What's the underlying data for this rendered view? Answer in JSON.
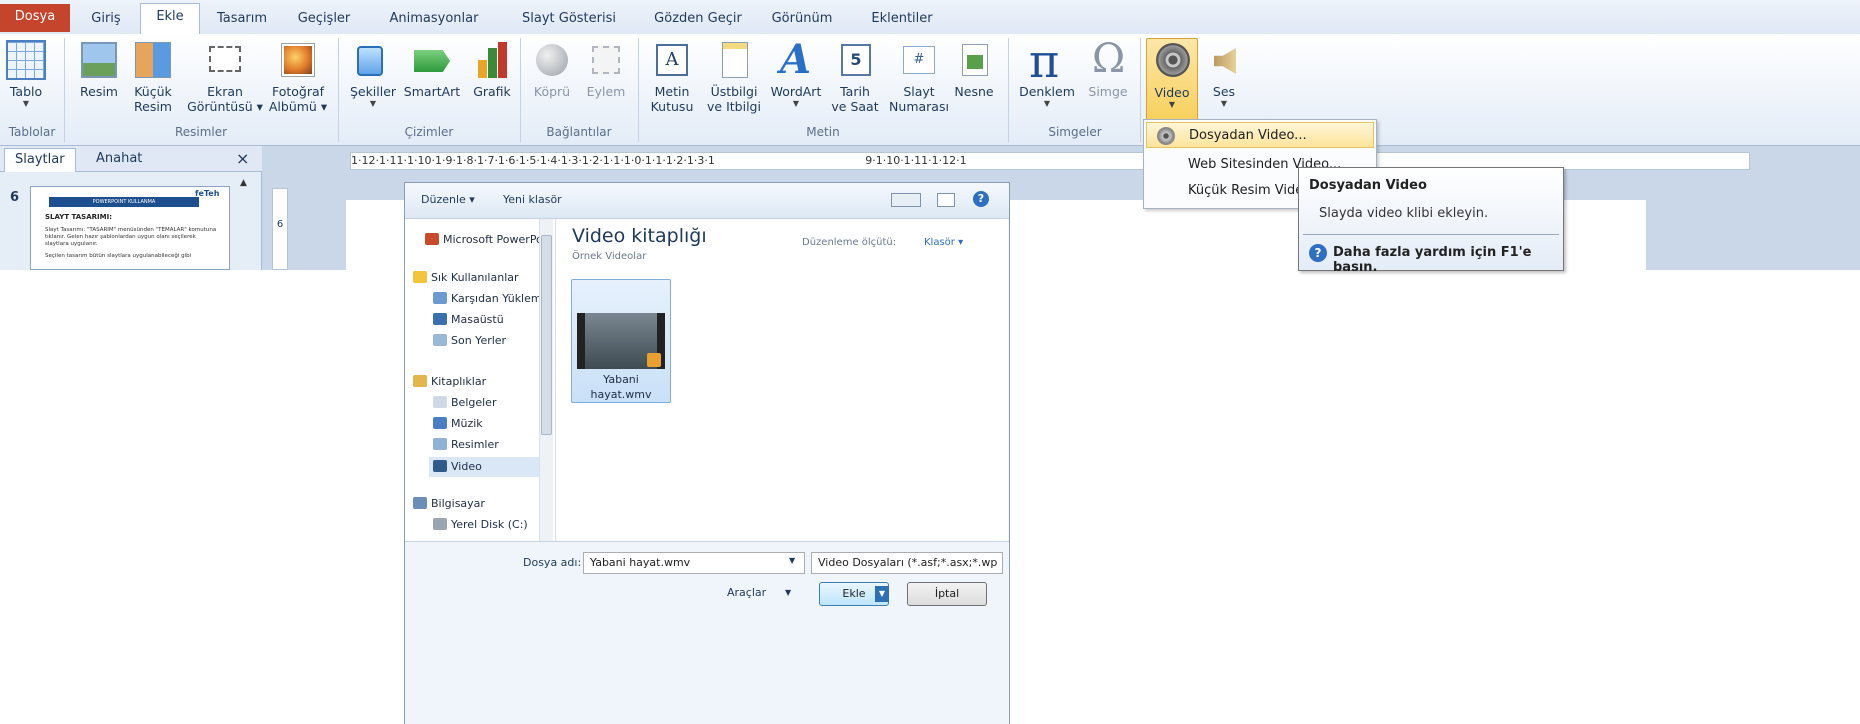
{
  "tabs": [
    "Dosya",
    "Giriş",
    "Ekle",
    "Tasarım",
    "Geçişler",
    "Animasyonlar",
    "Slayt Gösterisi",
    "Gözden Geçir",
    "Görünüm",
    "Eklentiler"
  ],
  "ribbon": {
    "tablo": "Tablo",
    "resim": "Resim",
    "kucuk_resim": [
      "Küçük",
      "Resim"
    ],
    "ekran": [
      "Ekran",
      "Görüntüsü"
    ],
    "fotograf": [
      "Fotoğraf",
      "Albümü"
    ],
    "sekiller": "Şekiller",
    "smartart": "SmartArt",
    "grafik": "Grafik",
    "kopru": "Köprü",
    "eylem": "Eylem",
    "metin_kutusu": [
      "Metin",
      "Kutusu"
    ],
    "ustbilgi": [
      "Üstbilgi",
      "ve Itbilgi"
    ],
    "wordart": "WordArt",
    "tarih": [
      "Tarih",
      "ve Saat"
    ],
    "slayt_num": [
      "Slayt",
      "Numarası"
    ],
    "nesne": "Nesne",
    "denklem": "Denklem",
    "simge": "Simge",
    "video": "Video",
    "ses": "Ses",
    "groups": {
      "tablolar": "Tablolar",
      "resimler": "Resimler",
      "cizimler": "Çizimler",
      "baglantilar": "Bağlantılar",
      "metin": "Metin",
      "simgeler": "Simgeler"
    },
    "icon_names": {
      "calendar_digit": "5",
      "number_sign": "#",
      "textbox_glyph": "A"
    }
  },
  "pane": {
    "tab_slides": "Slaytlar",
    "tab_outline": "Anahat",
    "close": "×",
    "slide_number": "6"
  },
  "thumb": {
    "header": "POWERPOINT KULLANMA",
    "logo": "feTeh",
    "title": "SLAYT TASARIMI:",
    "bullets": [
      "Slayt Tasarımı: \"TASARIM\" menüsünden \"TEMALAR\" komutuna tıklanır. Gelen hazır şablonlardan uygun olanı seçilerek slaytlara uygulanır.",
      "Seçilen tasarım bütün slaytlara uygulanabileceği gibi"
    ]
  },
  "ruler_text": "1·12·1·11·1·10·1·9·1·8·1·7·1·6·1·5·1·4·1·3·1·2·1·1·1·0·1·1·1·2·1·3·1",
  "ruler_right": "9·1·10·1·11·1·12·1",
  "vruler": "6",
  "menu": {
    "items": [
      {
        "label": "Dosyadan Video...",
        "highlighted": true
      },
      {
        "label": "Web Sitesinden Video...",
        "highlighted": false
      },
      {
        "label": "Küçük Resim Video...",
        "highlighted": false
      }
    ]
  },
  "tooltip": {
    "title": "Dosyadan Video",
    "body": "Slayda video klibi ekleyin.",
    "help": "Daha fazla yardım için F1'e basın."
  },
  "dialog": {
    "organize": "Düzenle ▾",
    "new_folder": "Yeni klasör",
    "library_title": "Video kitaplığı",
    "library_sub": "Örnek Videolar",
    "arrange_label": "Düzenleme ölçütü:",
    "arrange_value": "Klasör ▾",
    "nav": {
      "top": "Microsoft PowerPo",
      "favorites": "Sık Kullanılanlar",
      "downloads": "Karşıdan Yüklem",
      "desktop": "Masaüstü",
      "recent": "Son Yerler",
      "libraries": "Kitaplıklar",
      "docs": "Belgeler",
      "music": "Müzik",
      "pictures": "Resimler",
      "video": "Video",
      "computer": "Bilgisayar",
      "disk": "Yerel Disk (C:)"
    },
    "file": {
      "name_line1": "Yabani",
      "name_line2": "hayat.wmv"
    },
    "filename_label": "Dosya adı:",
    "filename_value": "Yabani hayat.wmv",
    "filter": "Video Dosyaları (*.asf;*.asx;*.wp",
    "tools": "Araçlar",
    "insert": "Ekle",
    "cancel": "İptal"
  },
  "colors": {
    "file_tab": "#c5442c",
    "accent": "#1e395b",
    "highlight": "#fde49b"
  }
}
